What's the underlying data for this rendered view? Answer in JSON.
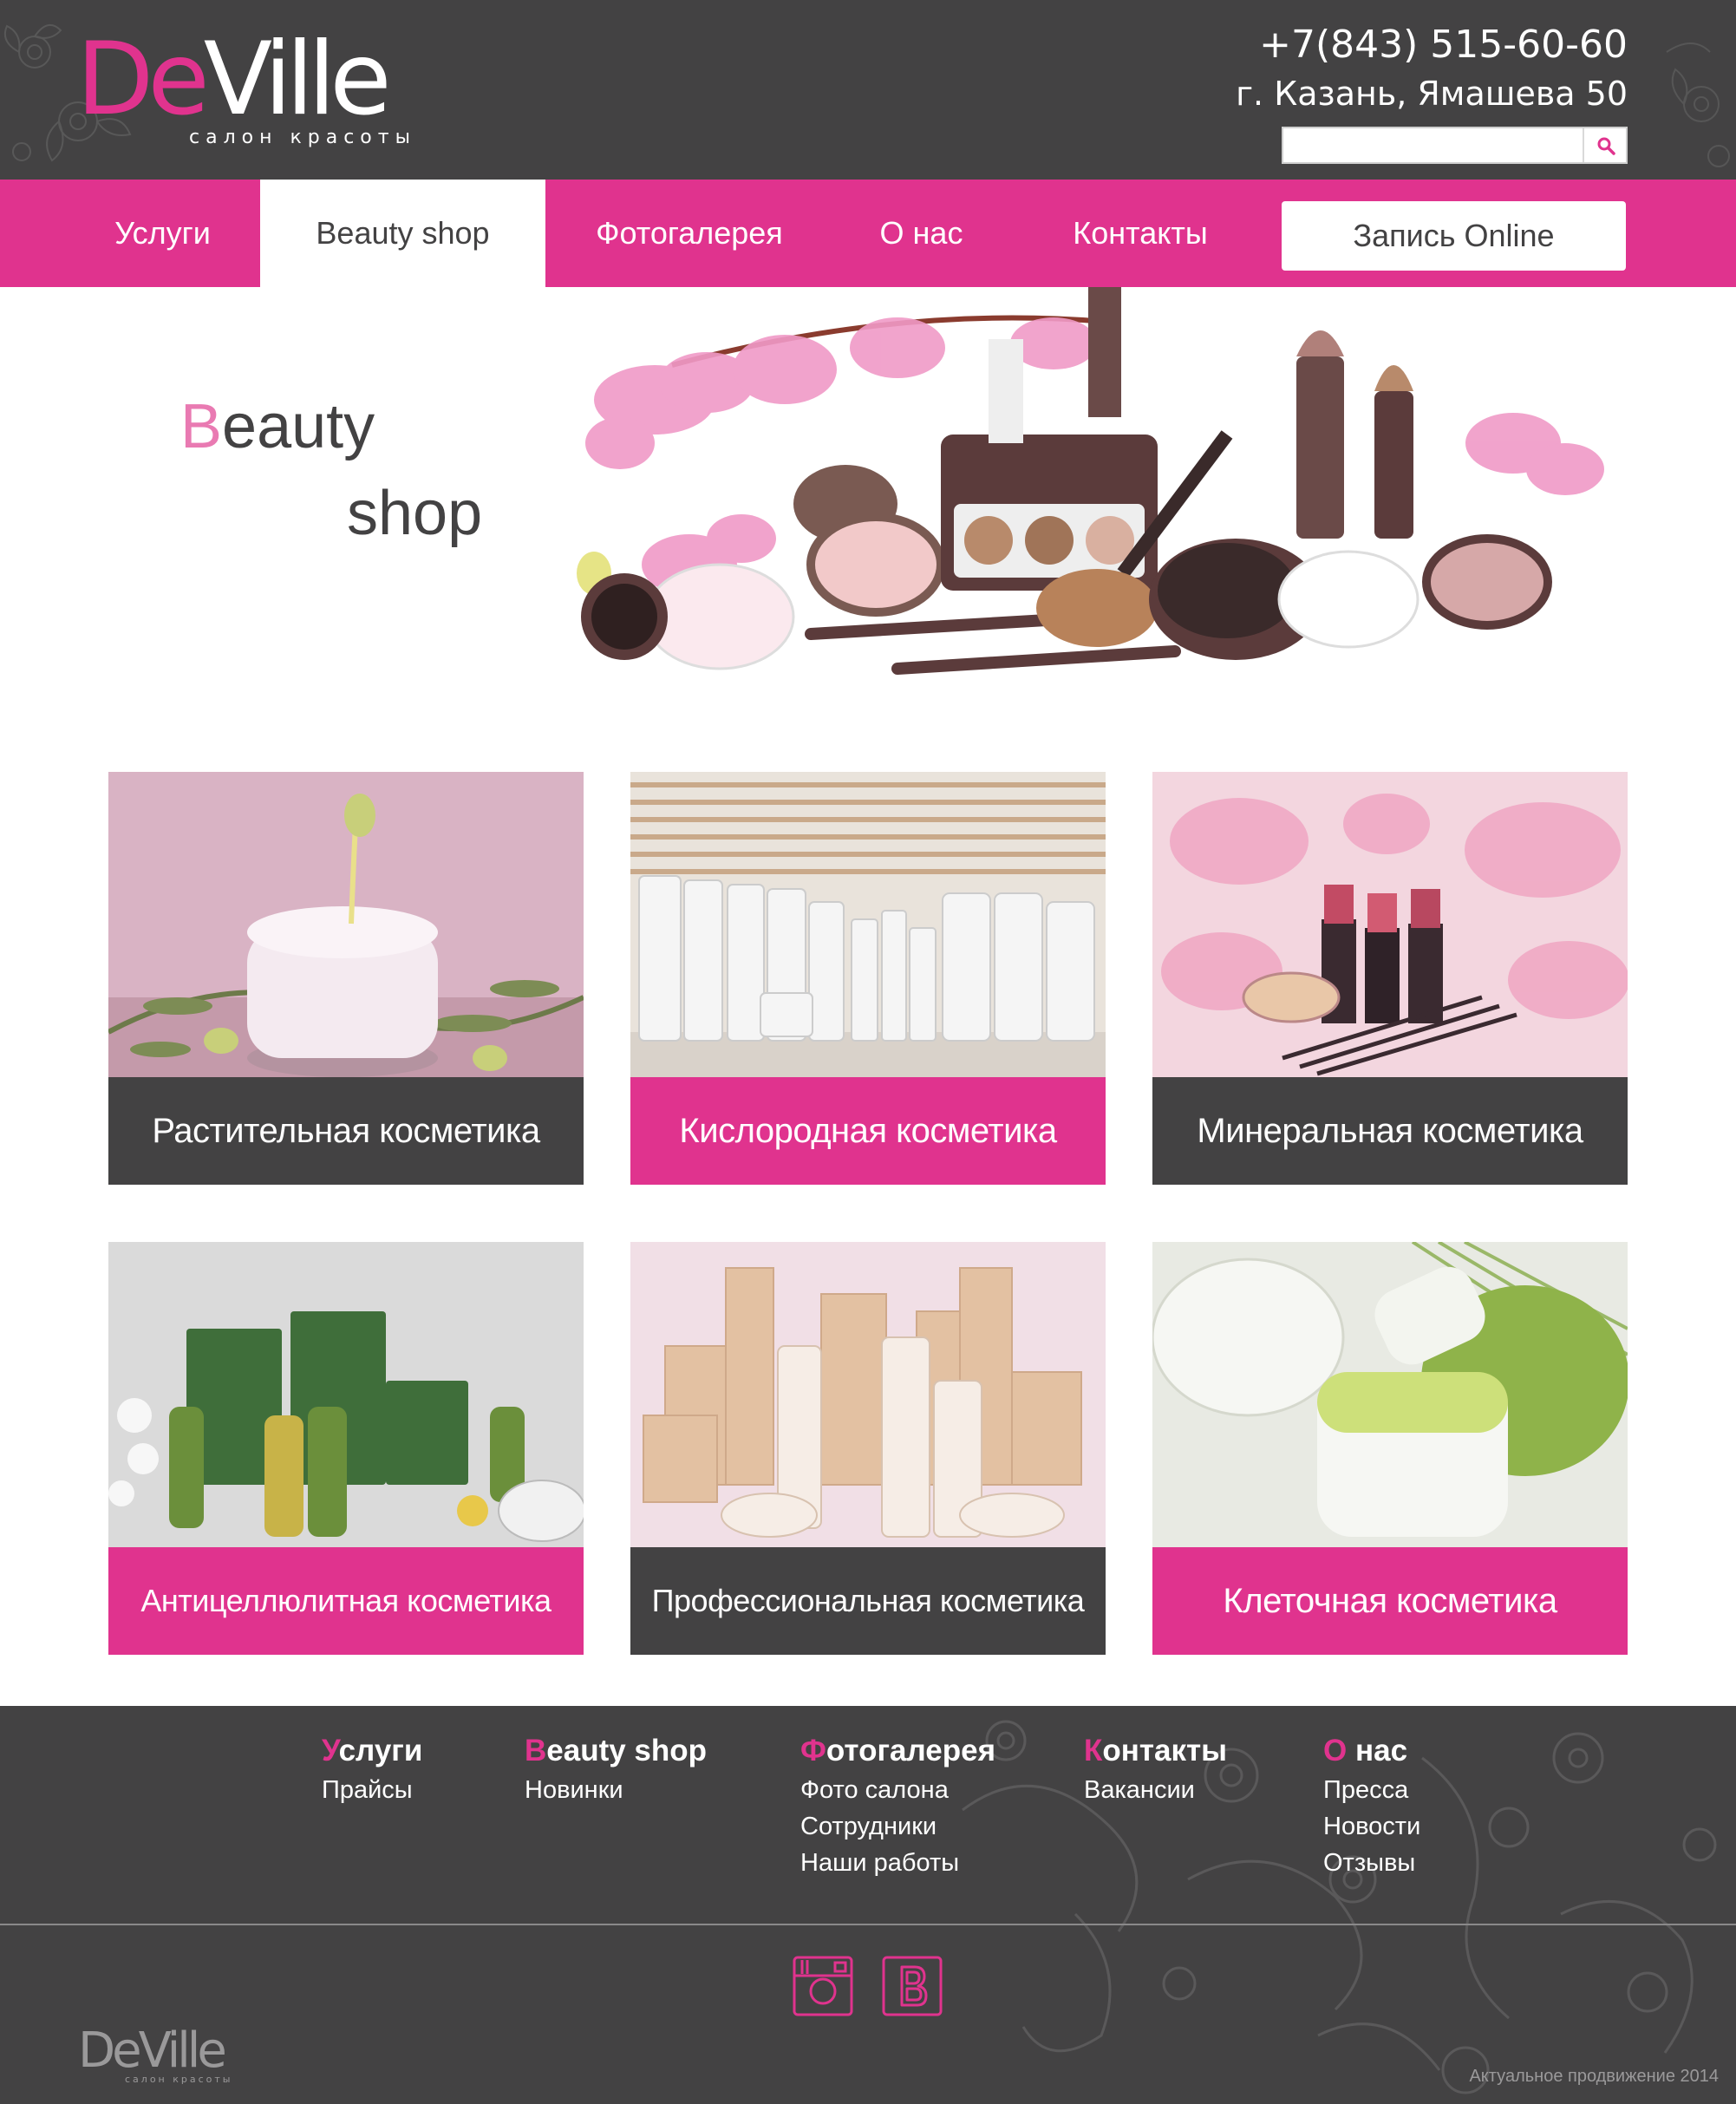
{
  "header": {
    "logo": {
      "part1": "De",
      "part2": "Ville",
      "subtitle": "салон красоты"
    },
    "phone": "+7(843) 515-60-60",
    "address": "г. Казань, Ямашева 50",
    "search": {
      "value": "",
      "placeholder": "",
      "icon": "search-icon"
    }
  },
  "nav": {
    "items": [
      {
        "label": "Услуги"
      },
      {
        "label": "Beauty shop",
        "active": true
      },
      {
        "label": "Фотогалерея"
      },
      {
        "label": "О нас"
      },
      {
        "label": "Контакты"
      }
    ],
    "cta": "Запись Online"
  },
  "hero": {
    "title_first_letter": "B",
    "title_rest": "eauty",
    "title_line2": "shop"
  },
  "categories": [
    {
      "label": "Растительная косметика",
      "style": "dark"
    },
    {
      "label": "Кислородная косметика",
      "style": "pink"
    },
    {
      "label": "Минеральная косметика",
      "style": "dark"
    },
    {
      "label": "Антицеллюлитная косметика",
      "style": "pink"
    },
    {
      "label": "Профессиональная косметика",
      "style": "dark"
    },
    {
      "label": "Клеточная косметика",
      "style": "pink"
    }
  ],
  "footer": {
    "columns": [
      {
        "head_first": "У",
        "head_rest": "слуги",
        "links": [
          "Прайсы"
        ]
      },
      {
        "head_first": "B",
        "head_rest": "eauty shop",
        "links": [
          "Новинки"
        ]
      },
      {
        "head_first": "Ф",
        "head_rest": "отогалерея",
        "links": [
          "Фото салона",
          "Сотрудники",
          "Наши работы"
        ]
      },
      {
        "head_first": "К",
        "head_rest": "онтакты",
        "links": [
          "Вакансии"
        ]
      },
      {
        "head_first": "О",
        "head_rest": " нас",
        "links": [
          "Пресса",
          "Новости",
          "Отзывы"
        ]
      }
    ],
    "social": [
      {
        "icon": "instagram-icon"
      },
      {
        "icon": "vkontakte-icon"
      }
    ],
    "logo": {
      "part1": "De",
      "part2": "Ville",
      "subtitle": "салон красоты"
    },
    "copyright": "Актуальное продвижение 2014"
  },
  "colors": {
    "accent": "#e0338e",
    "dark": "#434243",
    "white": "#ffffff"
  }
}
